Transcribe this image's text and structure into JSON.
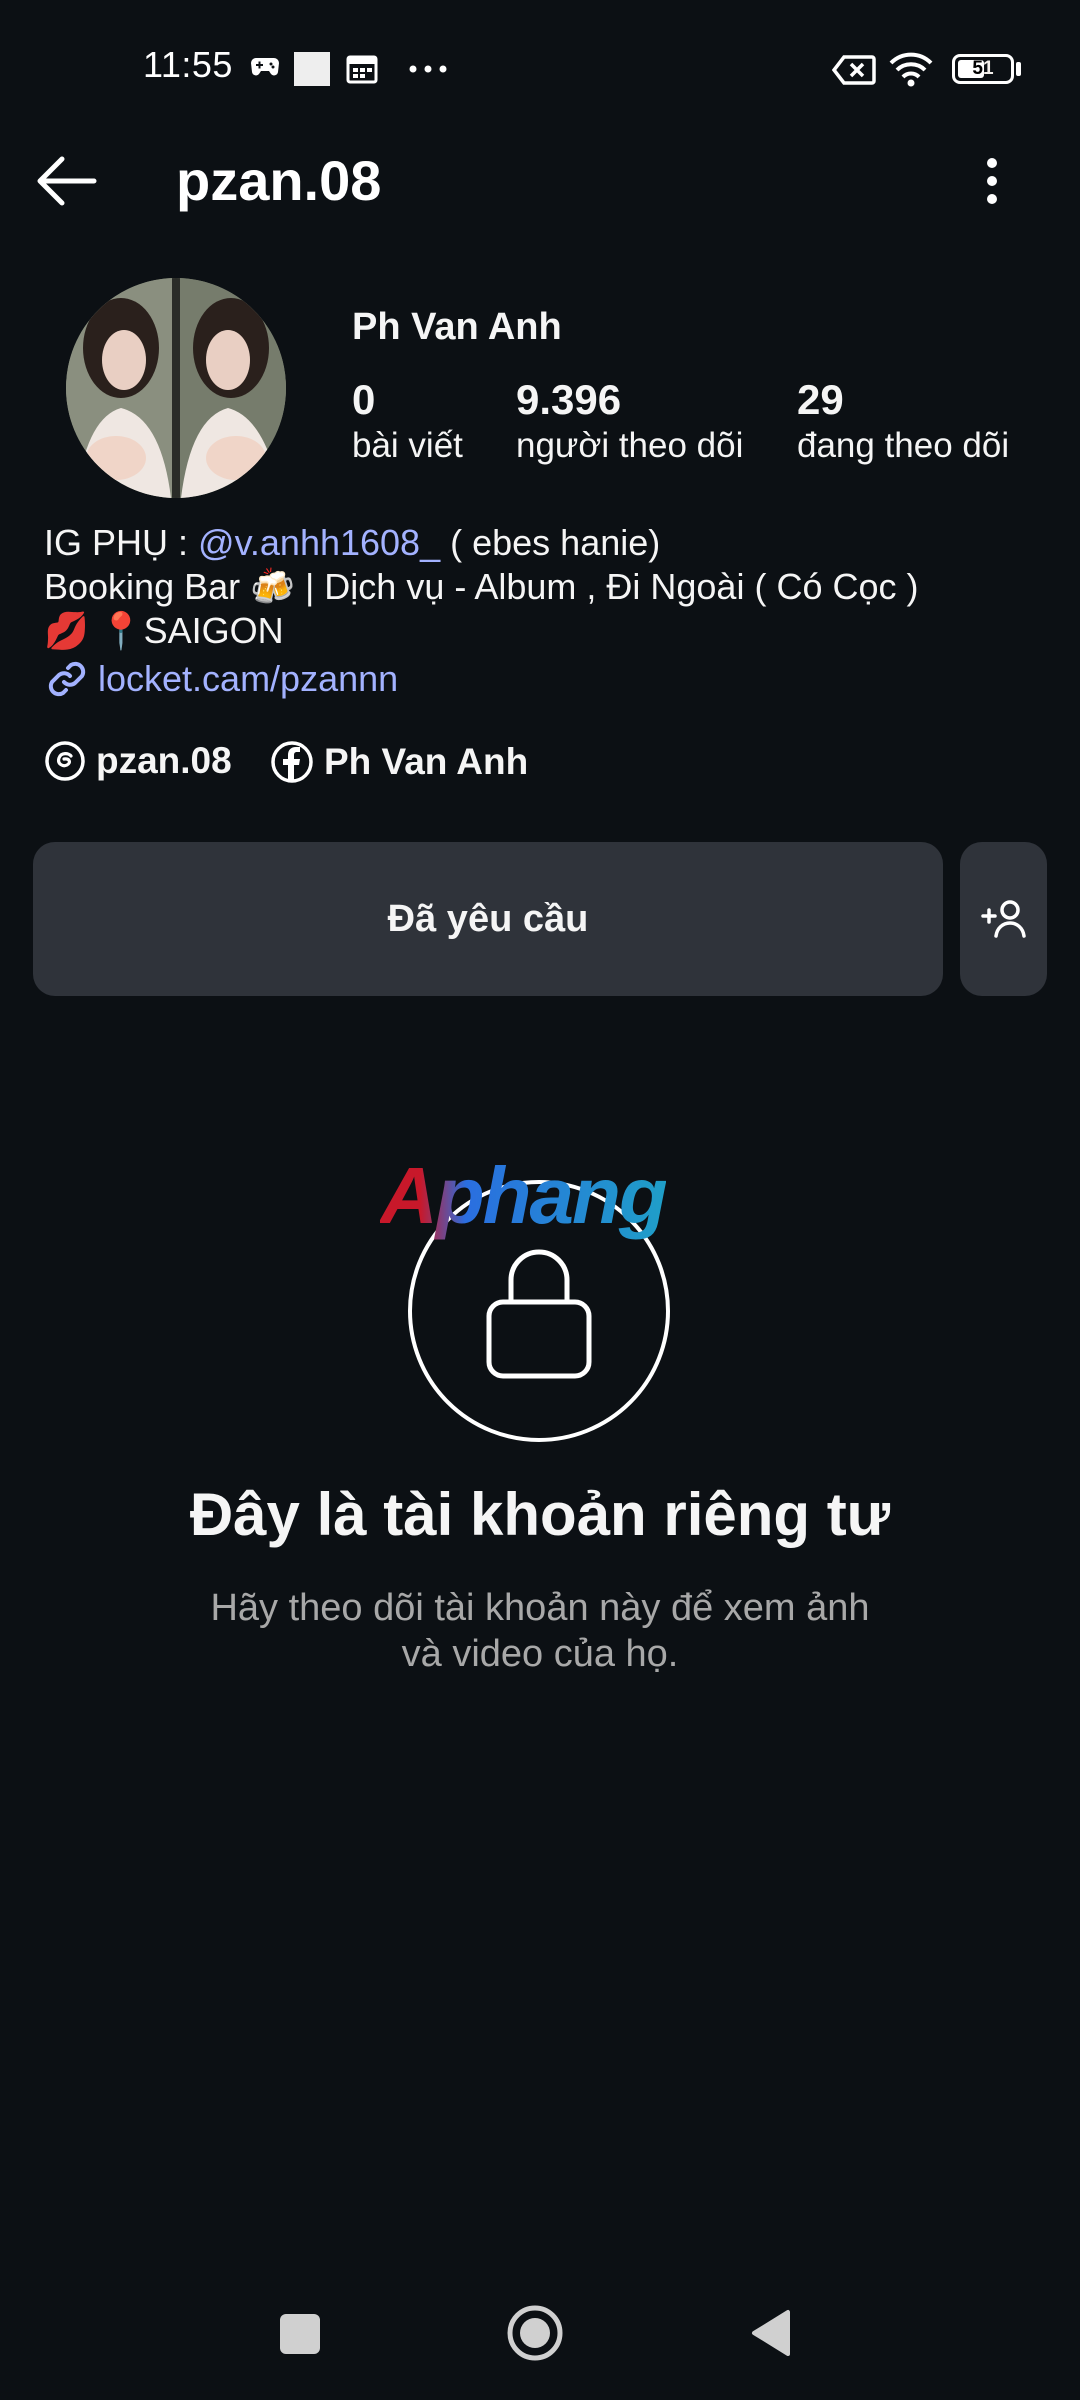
{
  "status_bar": {
    "time": "11:55",
    "battery": "51",
    "icons": [
      "gamepad-icon",
      "square-icon",
      "calendar-icon",
      "more-dots-icon",
      "sim-blocked-icon",
      "wifi-icon",
      "battery-icon"
    ]
  },
  "header": {
    "username": "pzan.08",
    "back_icon": "arrow-left-icon",
    "more_icon": "vertical-dots-icon"
  },
  "profile": {
    "display_name": "Ph Van Anh",
    "stats": [
      {
        "value": "0",
        "label": "bài viết"
      },
      {
        "value": "9.396",
        "label": "người theo dõi"
      },
      {
        "value": "29",
        "label": "đang theo dõi"
      }
    ],
    "bio": {
      "line1_prefix": "IG PHỤ : ",
      "line1_mention": "@v.anhh1608_",
      "line1_suffix": " ( ebes hanie)",
      "line2": "Booking Bar 🍻  |   Dịch vụ - Album , Đi Ngoài  ( Có Cọc )",
      "line3": "💋  📍SAIGON",
      "link": "locket.cam/pzannn"
    },
    "threads_label": "pzan.08",
    "facebook_label": "Ph Van Anh"
  },
  "actions": {
    "requested_label": "Đã yêu cầu",
    "add_friend_icon": "add-person-icon"
  },
  "private": {
    "watermark": "Aphang",
    "title": "Đây là tài khoản riêng tư",
    "subtitle_line1": "Hãy theo dõi tài khoản này để xem ảnh",
    "subtitle_line2": "và video của họ."
  },
  "nav": {
    "icons": [
      "recents-square-icon",
      "home-circle-icon",
      "back-triangle-icon"
    ]
  },
  "colors": {
    "background": "#0c1014",
    "button": "#2f333a",
    "link": "#a3b2ff",
    "muted": "#a8a8a8"
  }
}
